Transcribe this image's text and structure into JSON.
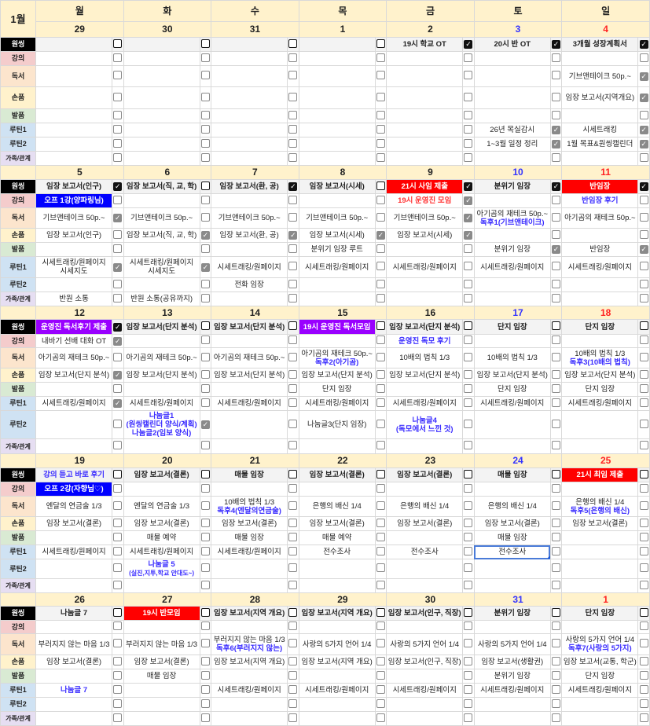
{
  "month_label": "1월",
  "weekdays": [
    "월",
    "화",
    "수",
    "목",
    "금",
    "토",
    "일"
  ],
  "categories": [
    "원씽",
    "강의",
    "독서",
    "손품",
    "발품",
    "루틴1",
    "루틴2",
    "가족/관계"
  ],
  "colors": {
    "red_bg": "#ff0000",
    "blue_bg": "#0000ff",
    "purple_bg": "#9900ff",
    "blue_text": "#3a2cff",
    "red_text": "#ff3333",
    "header_bg": "#fff2cc"
  },
  "weeks": [
    {
      "dates": [
        "29",
        "30",
        "31",
        "1",
        "2",
        "3",
        "4"
      ],
      "rows": [
        {
          "cells": [
            "",
            "",
            "",
            "",
            {
              "text": "19시 학교 OT",
              "checked": true
            },
            {
              "text": "20시 반 OT",
              "checked": true
            },
            {
              "text": "3개월 성장계획서",
              "checked": true
            }
          ]
        },
        {
          "cells": [
            "",
            "",
            "",
            "",
            "",
            "",
            ""
          ]
        },
        {
          "cells": [
            "",
            "",
            "",
            "",
            "",
            "",
            {
              "text": "기브앤테이크 50p.~",
              "checked": true
            }
          ]
        },
        {
          "cells": [
            "",
            "",
            "",
            "",
            "",
            "",
            {
              "text": "임장 보고서(지역개요)",
              "checked": true
            }
          ]
        },
        {
          "cells": [
            "",
            "",
            "",
            "",
            "",
            "",
            ""
          ]
        },
        {
          "cells": [
            "",
            "",
            "",
            "",
            "",
            {
              "text": "26년 목실감시",
              "checked": true
            },
            {
              "text": "시세트래킹",
              "checked": true
            }
          ]
        },
        {
          "cells": [
            "",
            "",
            "",
            "",
            "",
            {
              "text": "1~3월 일정 정리",
              "checked": true
            },
            {
              "text": "1월 목표&원씽캘린더",
              "checked": true
            }
          ]
        },
        {
          "cells": [
            "",
            "",
            "",
            "",
            "",
            "",
            ""
          ]
        }
      ]
    },
    {
      "dates": [
        "5",
        "6",
        "7",
        "8",
        "9",
        "10",
        "11"
      ],
      "rows": [
        {
          "cells": [
            {
              "text": "임장 보고서(인구)",
              "checked": true
            },
            "임장 보고서(직, 교, 학)",
            {
              "text": "임장 보고서(환, 공)",
              "checked": true
            },
            "임장 보고서(시세)",
            {
              "text": "21시 사임 제출",
              "style": "red-bg",
              "checked": true
            },
            {
              "text": "분위기 임장",
              "checked": true
            },
            {
              "text": "반임장",
              "style": "red-bg",
              "checked": true
            }
          ]
        },
        {
          "cells": [
            {
              "text": "오프 1강(양파링님)",
              "style": "blue-bg"
            },
            "",
            "",
            "",
            {
              "text": "19시 운영진 모임",
              "style": "red-text",
              "checked": true
            },
            "",
            {
              "text": "반임장 후기",
              "style": "blue-text"
            }
          ]
        },
        {
          "cells": [
            {
              "text": "기브앤테이크 50p.~",
              "checked": true
            },
            "기브앤테이크 50p.~",
            "기브앤테이크 50p.~",
            "기브앤테이크 50p.~",
            {
              "text": "기브앤테이크 50p.~",
              "checked": true
            },
            {
              "text": "아기곰의 재테크 50p.~",
              "sub": "독후1(기브앤테이크)",
              "sub_style": "blue-text"
            },
            "아기곰의 재테크 50p.~"
          ]
        },
        {
          "cells": [
            "임장 보고서(인구)",
            {
              "text": "임장 보고서(직, 교, 학)",
              "checked": true
            },
            {
              "text": "임장 보고서(환, 공)",
              "checked": true
            },
            {
              "text": "임장 보고서(시세)",
              "checked": true
            },
            {
              "text": "임장 보고서(시세)",
              "checked": true
            },
            "",
            ""
          ]
        },
        {
          "cells": [
            "",
            "",
            "",
            "분위기 임장 루트",
            "",
            {
              "text": "분위기 임장",
              "checked": true
            },
            {
              "text": "반임장",
              "checked": true
            }
          ]
        },
        {
          "cells": [
            {
              "text": "시세트래킹/원페이지",
              "sub": "시세지도",
              "checked": true
            },
            {
              "text": "시세트래킹/원페이지",
              "sub": "시세지도",
              "checked": true
            },
            "시세트래킹/원페이지",
            "시세트래킹/원페이지",
            "시세트래킹/원페이지",
            "시세트래킹/원페이지",
            "시세트래킹/원페이지"
          ]
        },
        {
          "cells": [
            "",
            "",
            "전화 임장",
            "",
            "",
            "",
            ""
          ]
        },
        {
          "cells": [
            "반원 소통",
            "반원 소통(공유까지)",
            "",
            "",
            "",
            "",
            ""
          ]
        }
      ]
    },
    {
      "dates": [
        "12",
        "13",
        "14",
        "15",
        "16",
        "17",
        "18"
      ],
      "rows": [
        {
          "cells": [
            {
              "text": "운영진 독서후기 제출",
              "style": "purple-bg",
              "checked": true
            },
            "임장 보고서(단지 분석)",
            "임장 보고서(단지 분석)",
            {
              "text": "19시 운영진 독서모임",
              "style": "purple-bg"
            },
            "임장 보고서(단지 분석)",
            "단지 임장",
            "단지 임장"
          ]
        },
        {
          "cells": [
            {
              "text": "내바기 선배 대화 OT",
              "checked": true
            },
            "",
            "",
            "",
            {
              "text": "운영진 독모 후기",
              "style": "blue-text"
            },
            "",
            ""
          ]
        },
        {
          "cells": [
            "아기곰의 재테크 50p.~",
            "아기곰의 재테크 50p.~",
            "아기곰의 재테크 50p.~",
            {
              "text": "아기곰의 재테크 50p.~",
              "sub": "독후2(아기곰)",
              "sub_style": "blue-text"
            },
            "10배의 법칙 1/3",
            "10배의 법칙 1/3",
            {
              "text": "10배의 법칙 1/3",
              "sub": "독후3(10배의 법칙)",
              "sub_style": "blue-text"
            }
          ]
        },
        {
          "cells": [
            {
              "text": "임장 보고서(단지 분석)",
              "checked": true
            },
            "임장 보고서(단지 분석)",
            "임장 보고서(단지 분석)",
            "임장 보고서(단지 분석)",
            "임장 보고서(단지 분석)",
            "임장 보고서(단지 분석)",
            "임장 보고서(단지 분석)"
          ]
        },
        {
          "cells": [
            "",
            "",
            "",
            "단지 임장",
            "",
            "단지 임장",
            "단지 임장"
          ]
        },
        {
          "cells": [
            {
              "text": "시세트래킹/원페이지",
              "checked": true
            },
            "시세트래킹/원페이지",
            "시세트래킹/원페이지",
            "시세트래킹/원페이지",
            "시세트래킹/원페이지",
            "시세트래킹/원페이지",
            "시세트래킹/원페이지"
          ]
        },
        {
          "cells": [
            "",
            {
              "text": "나눔글1",
              "sub": "(원씽캘린더 양식/계획)",
              "sub3": "나눔글2(임보 양식)",
              "style": "blue-text",
              "sub_style": "blue-text",
              "checked": true
            },
            "",
            "나눔글3(단지 임장)",
            {
              "text": "나눔글4",
              "sub": "(독모에서 느낀 것)",
              "style": "blue-text",
              "sub_style": "blue-text"
            },
            "",
            ""
          ]
        },
        {
          "cells": [
            "",
            "",
            "",
            "",
            "",
            "",
            ""
          ]
        }
      ]
    },
    {
      "dates": [
        "19",
        "20",
        "21",
        "22",
        "23",
        "24",
        "25"
      ],
      "rows": [
        {
          "cells": [
            {
              "text": "강의 듣고 바로 후기",
              "style": "blue-text"
            },
            "임장 보고서(결론)",
            "매물 임장",
            "임장 보고서(결론)",
            "임장 보고서(결론)",
            "매물 임장",
            {
              "text": "21시 최임 제출",
              "style": "red-bg"
            }
          ]
        },
        {
          "cells": [
            {
              "text": "오프 2강(자향님♡)",
              "style": "blue-bg"
            },
            "",
            "",
            "",
            "",
            "",
            ""
          ]
        },
        {
          "cells": [
            "엔달의 연금술 1/3",
            "엔달의 연금술 1/3",
            {
              "text": "10배의 법칙 1/3",
              "sub": "독후4(엔달의연금술)",
              "sub_style": "blue-text"
            },
            "은행의 배신 1/4",
            "은행의 배신 1/4",
            "은행의 배신 1/4",
            {
              "text": "은행의 배신 1/4",
              "sub": "독후5(은행의 배신)",
              "sub_style": "blue-text"
            }
          ]
        },
        {
          "cells": [
            "임장 보고서(결론)",
            "임장 보고서(결론)",
            "임장 보고서(결론)",
            "임장 보고서(결론)",
            "임장 보고서(결론)",
            "임장 보고서(결론)",
            "임장 보고서(결론)"
          ]
        },
        {
          "cells": [
            "",
            "매물 예약",
            "매물 임장",
            "매물 예약",
            "",
            "매물 임장",
            ""
          ]
        },
        {
          "cells": [
            "시세트래킹/원페이지",
            "시세트래킹/원페이지",
            "시세트래킹/원페이지",
            "전수조사",
            "전수조사",
            {
              "text": "전수조사",
              "selected": true
            },
            ""
          ]
        },
        {
          "cells": [
            "",
            {
              "text": "나눔글 5",
              "sub": "(실진,지투,학교 안대도~)",
              "style": "blue-text",
              "sub_style": "blue-text small"
            },
            "",
            "",
            "",
            "",
            ""
          ]
        },
        {
          "cells": [
            "",
            "",
            "",
            "",
            "",
            "",
            ""
          ]
        }
      ]
    },
    {
      "dates": [
        "26",
        "27",
        "28",
        "29",
        "30",
        "31",
        "1"
      ],
      "rows": [
        {
          "cells": [
            "나눔글 7",
            {
              "text": "19시 반모임",
              "style": "red-bg"
            },
            "임장 보고서(지역 개요)",
            "임장 보고서(지역 개요)",
            "임장 보고서(인구, 직장)",
            "분위기 임장",
            "단지 임장"
          ]
        },
        {
          "cells": [
            "",
            "",
            "",
            "",
            "",
            "",
            ""
          ]
        },
        {
          "cells": [
            "부러지지 않는 마음 1/3",
            "부러지지 않는 마음 1/3",
            {
              "text": "부러지지 않는 마음 1/3",
              "sub": "독후6(부러지지 않는)",
              "sub_style": "blue-text"
            },
            "사랑의 5가지 언어 1/4",
            "사랑의 5가지 언어 1/4",
            "사랑의 5가지 언어 1/4",
            {
              "text": "사랑의 5가지 언어 1/4",
              "sub": "독후7(사랑의 5가지)",
              "sub_style": "blue-text"
            }
          ]
        },
        {
          "cells": [
            "임장 보고서(결론)",
            "임장 보고서(결론)",
            "임장 보고서(지역 개요)",
            "임장 보고서(지역 개요)",
            "임장 보고서(인구, 직장)",
            "임장 보고서(생활권)",
            "임장 보고서(교통, 학군)"
          ]
        },
        {
          "cells": [
            "",
            "매물 임장",
            "",
            "",
            "",
            "분위기 임장",
            "단지 임장"
          ]
        },
        {
          "cells": [
            {
              "text": "나눔글 7",
              "style": "blue-text"
            },
            "",
            "시세트래킹/원페이지",
            "시세트래킹/원페이지",
            "시세트래킹/원페이지",
            "시세트래킹/원페이지",
            "시세트래킹/원페이지"
          ]
        },
        {
          "cells": [
            "",
            "",
            "",
            "",
            "",
            "",
            ""
          ]
        },
        {
          "cells": [
            "",
            "",
            "",
            "",
            "",
            "",
            ""
          ]
        }
      ]
    }
  ]
}
